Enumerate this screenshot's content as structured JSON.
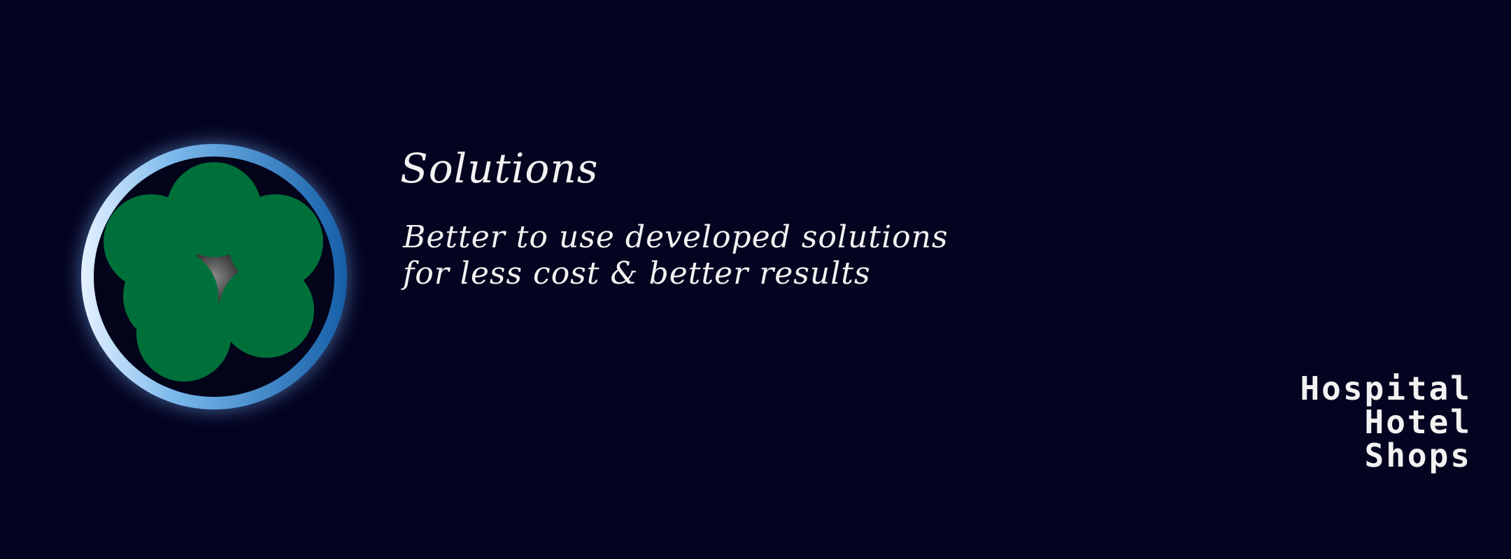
{
  "logo": {
    "ring_light_color": "#d8ecff",
    "ring_dark_color": "#1f78c6",
    "circle_color": "#00703a",
    "center_color": "#6b6b6b"
  },
  "headline": {
    "title": "Solutions",
    "lines": [
      "Better to use developed solutions",
      "for less cost & better results"
    ]
  },
  "sectors": [
    "Hospital",
    "Hotel",
    "Shops"
  ],
  "colors": {
    "background": "#040420",
    "text": "#f2f2f2"
  }
}
